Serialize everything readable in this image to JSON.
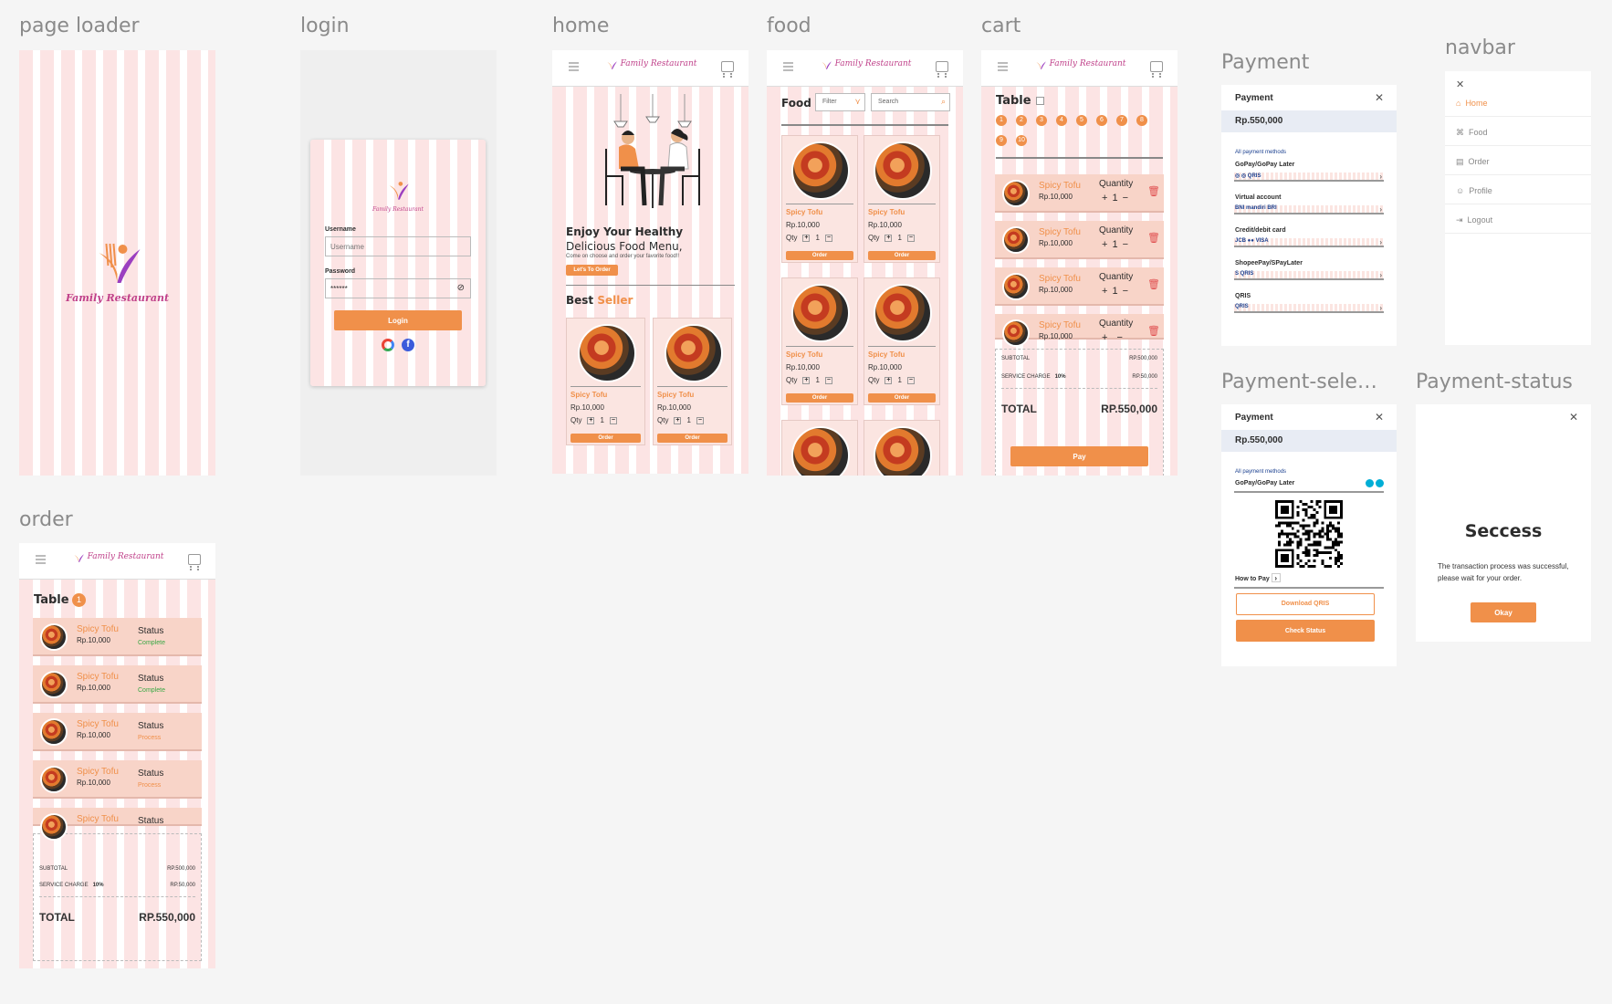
{
  "frames": {
    "page_loader": "page loader",
    "login": "login",
    "home": "home",
    "food": "food",
    "cart": "cart",
    "payment": "Payment",
    "navbar": "navbar",
    "payment_select": "Payment-selec...",
    "payment_status": "Payment-status",
    "order": "order"
  },
  "brand": {
    "name": "Family Restaurant"
  },
  "colors": {
    "accent": "#f0904a",
    "stripe": "#fce4e4",
    "brand_text": "#c0418a"
  },
  "login": {
    "username_label": "Username",
    "username_placeholder": "Username",
    "password_label": "Password",
    "password_value": "******",
    "login_button": "Login"
  },
  "home": {
    "headline_1": "Enjoy Your Healthy",
    "headline_2": "Delicious Food Menu,",
    "subtext": "Come on choose and order your favorite food!!",
    "cta": "Let's To Order",
    "best": "Best",
    "seller": "Seller",
    "products": [
      {
        "name": "Spicy Tofu",
        "price": "Rp.10,000",
        "qty_label": "Qty",
        "qty": "1",
        "button": "Order"
      },
      {
        "name": "Spicy Tofu",
        "price": "Rp.10,000",
        "qty_label": "Qty",
        "qty": "1",
        "button": "Order"
      }
    ]
  },
  "food": {
    "title": "Food",
    "filter": "Filter",
    "search_placeholder": "Search",
    "products": [
      {
        "name": "Spicy Tofu",
        "price": "Rp.10,000",
        "qty_label": "Qty",
        "qty": "1",
        "button": "Order"
      },
      {
        "name": "Spicy Tofu",
        "price": "Rp.10,000",
        "qty_label": "Qty",
        "qty": "1",
        "button": "Order"
      },
      {
        "name": "Spicy Tofu",
        "price": "Rp.10,000",
        "qty_label": "Qty",
        "qty": "1",
        "button": "Order"
      },
      {
        "name": "Spicy Tofu",
        "price": "Rp.10,000",
        "qty_label": "Qty",
        "qty": "1",
        "button": "Order"
      }
    ]
  },
  "cart": {
    "title": "Table",
    "tables": [
      "1",
      "2",
      "3",
      "4",
      "5",
      "6",
      "7",
      "8",
      "9",
      "10"
    ],
    "items": [
      {
        "name": "Spicy Tofu",
        "price": "Rp.10,000",
        "qty_label": "Quantity",
        "qty": "1"
      },
      {
        "name": "Spicy Tofu",
        "price": "Rp.10,000",
        "qty_label": "Quantity",
        "qty": "1"
      },
      {
        "name": "Spicy Tofu",
        "price": "Rp.10,000",
        "qty_label": "Quantity",
        "qty": "1"
      },
      {
        "name": "Spicy Tofu",
        "price": "Rp.10,000",
        "qty_label": "Quantity",
        "qty": ""
      }
    ],
    "subtotal_label": "SUBTOTAL",
    "subtotal_value": "RP.500,000",
    "service_label": "SERVICE CHARGE",
    "service_pct": "10%",
    "service_value": "RP.50,000",
    "total_label": "TOTAL",
    "total_value": "RP.550,000",
    "pay_button": "Pay"
  },
  "payment": {
    "title": "Payment",
    "amount": "Rp.550,000",
    "section": "All payment methods",
    "methods": [
      {
        "label": "GoPay/GoPay Later",
        "icons": "◎ ◎ QRIS"
      },
      {
        "label": "Virtual account",
        "icons": "BNI mandiri BRI"
      },
      {
        "label": "Credit/debit card",
        "icons": "JCB ●● VISA"
      },
      {
        "label": "ShopeePay/SPayLater",
        "icons": "S QRIS"
      },
      {
        "label": "QRIS",
        "icons": "QRIS"
      }
    ]
  },
  "navbar": {
    "items": [
      {
        "label": "Home",
        "icon": "⌂"
      },
      {
        "label": "Food",
        "icon": "⌘"
      },
      {
        "label": "Order",
        "icon": "▤"
      },
      {
        "label": "Profile",
        "icon": "☺"
      },
      {
        "label": "Logout",
        "icon": "⇥"
      }
    ]
  },
  "payment_select": {
    "title": "Payment",
    "amount": "Rp.550,000",
    "section": "All payment methods",
    "method": "GoPay/GoPay Later",
    "how_to_pay": "How to Pay",
    "download": "Download QRIS",
    "check": "Check Status"
  },
  "payment_status": {
    "title": "Seccess",
    "message": "The transaction process was successful, please wait for your order.",
    "button": "Okay"
  },
  "order": {
    "title": "Table",
    "table_no": "1",
    "items": [
      {
        "name": "Spicy Tofu",
        "price": "Rp.10,000",
        "status_label": "Status",
        "status": "Complete",
        "status_color": "#3aa845"
      },
      {
        "name": "Spicy Tofu",
        "price": "Rp.10,000",
        "status_label": "Status",
        "status": "Complete",
        "status_color": "#3aa845"
      },
      {
        "name": "Spicy Tofu",
        "price": "Rp.10,000",
        "status_label": "Status",
        "status": "Process",
        "status_color": "#f0904a"
      },
      {
        "name": "Spicy Tofu",
        "price": "Rp.10,000",
        "status_label": "Status",
        "status": "Process",
        "status_color": "#f0904a"
      },
      {
        "name": "Spicy Tofu",
        "price": "",
        "status_label": "Status",
        "status": "",
        "status_color": "#f0904a"
      }
    ],
    "subtotal_label": "SUBTOTAL",
    "subtotal_value": "RP.500,000",
    "service_label": "SERVICE CHARGE",
    "service_pct": "10%",
    "service_value": "RP.50,000",
    "total_label": "TOTAL",
    "total_value": "RP.550,000"
  }
}
